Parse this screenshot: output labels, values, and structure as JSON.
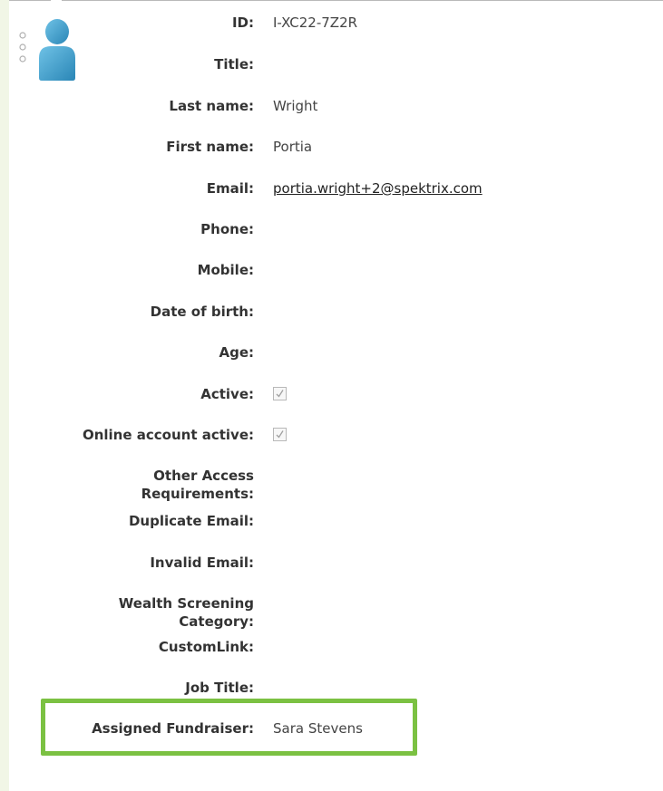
{
  "contact": {
    "fields": {
      "id": {
        "label": "ID:",
        "value": "I-XC22-7Z2R"
      },
      "title": {
        "label": "Title:",
        "value": ""
      },
      "last_name": {
        "label": "Last name:",
        "value": "Wright"
      },
      "first_name": {
        "label": "First name:",
        "value": "Portia"
      },
      "email": {
        "label": "Email:",
        "value": "portia.wright+2@spektrix.com"
      },
      "phone": {
        "label": "Phone:",
        "value": ""
      },
      "mobile": {
        "label": "Mobile:",
        "value": ""
      },
      "date_of_birth": {
        "label": "Date of birth:",
        "value": ""
      },
      "age": {
        "label": "Age:",
        "value": ""
      },
      "active": {
        "label": "Active:",
        "checked": true
      },
      "online_account_active": {
        "label": "Online account active:",
        "checked": true
      },
      "other_access_requirements": {
        "label": "Other Access Requirements:",
        "value": ""
      },
      "duplicate_email": {
        "label": "Duplicate Email:",
        "value": ""
      },
      "invalid_email": {
        "label": "Invalid Email:",
        "value": ""
      },
      "wealth_screening_category": {
        "label": "Wealth Screening Category:",
        "value": ""
      },
      "custom_link": {
        "label": "CustomLink:",
        "value": ""
      },
      "job_title": {
        "label": "Job Title:",
        "value": ""
      },
      "assigned_fundraiser": {
        "label": "Assigned Fundraiser:",
        "value": "Sara Stevens"
      }
    }
  },
  "colors": {
    "highlight": "#7bc142",
    "avatar": "#3a9cc9",
    "left_strip": "#f1f6e6"
  },
  "icons": {
    "avatar": "person-icon",
    "grip": "grip-dots-icon",
    "check": "checkmark-icon"
  }
}
